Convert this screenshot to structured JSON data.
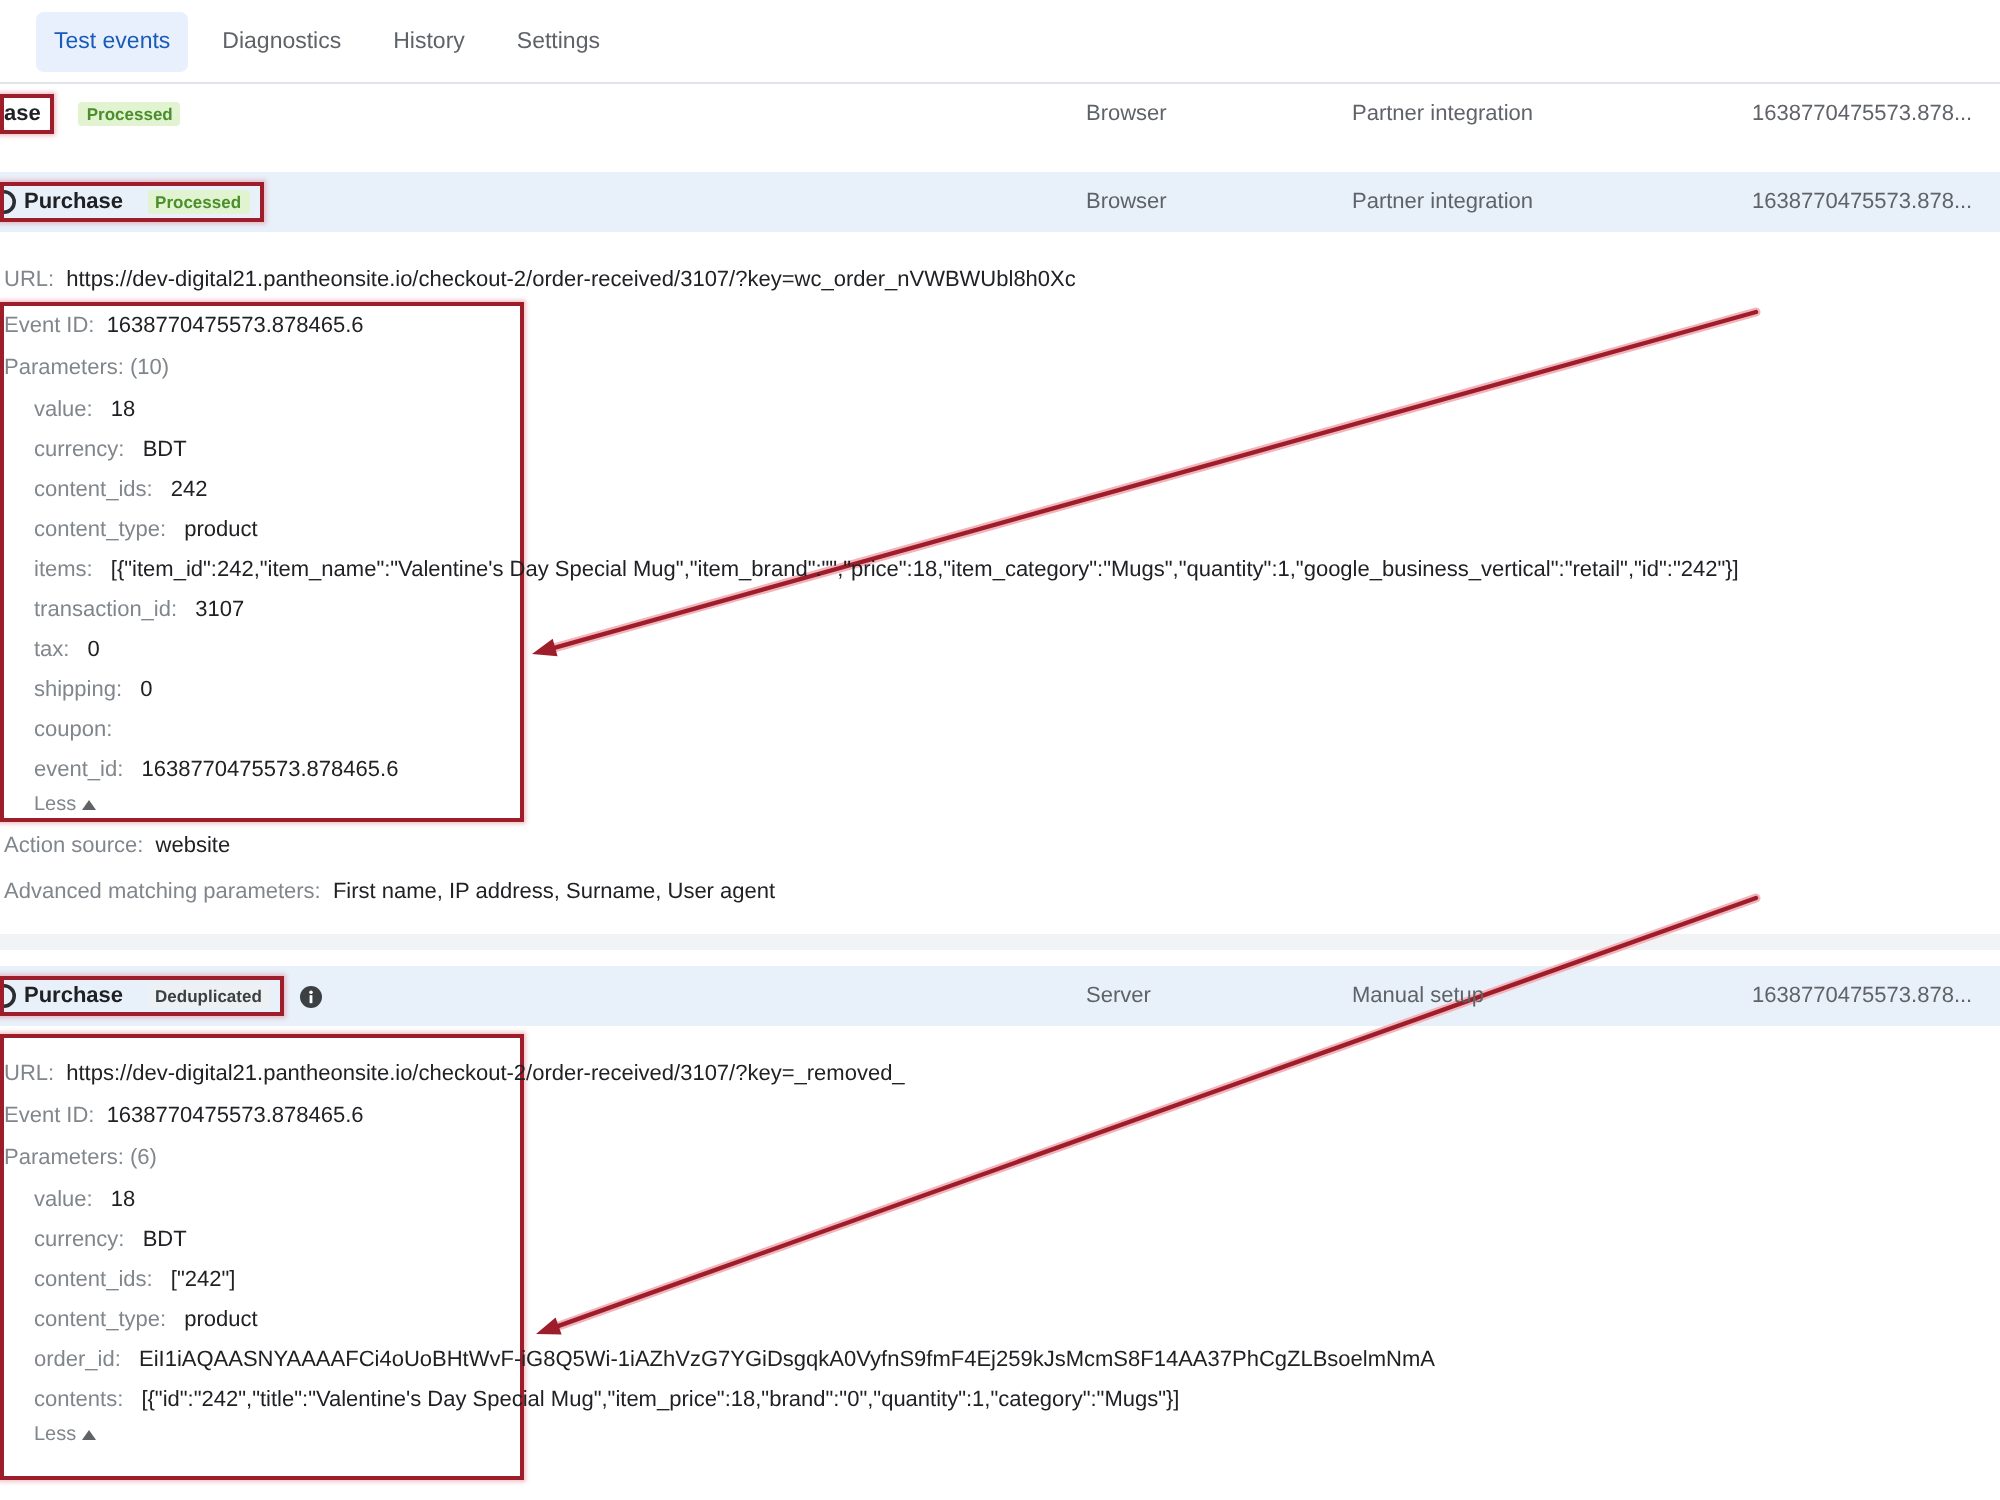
{
  "tabs": [
    {
      "label": "Test events",
      "selected": true
    },
    {
      "label": "Diagnostics",
      "selected": false
    },
    {
      "label": "History",
      "selected": false
    },
    {
      "label": "Settings",
      "selected": false
    }
  ],
  "events": [
    {
      "name": "ase",
      "icon": false,
      "status": {
        "label": "Processed",
        "kind": "success"
      },
      "info_icon": false,
      "column_3": "Browser",
      "column_4": "Partner integration",
      "column_5": "1638770475573.878...",
      "expanded": false,
      "name_framed": true,
      "status_framed": false
    },
    {
      "name": "Purchase",
      "icon": true,
      "status": {
        "label": "Processed",
        "kind": "success"
      },
      "info_icon": false,
      "column_3": "Browser",
      "column_4": "Partner integration",
      "column_5": "1638770475573.878...",
      "expanded": true,
      "name_framed": true,
      "status_framed": true,
      "details": {
        "url_label": "URL:",
        "url": "https://dev-digital21.pantheonsite.io/checkout-2/order-received/3107/?key=wc_order_nVWBWUbl8h0Xc",
        "event_id_label": "Event ID:",
        "event_id": "1638770475573.878465.6",
        "parameters_label": "Parameters: (10)",
        "parameters": [
          {
            "key": "value:",
            "value": "18"
          },
          {
            "key": "currency:",
            "value": "BDT"
          },
          {
            "key": "content_ids:",
            "value": "242"
          },
          {
            "key": "content_type:",
            "value": "product"
          },
          {
            "key": "items:",
            "value": "[{\"item_id\":242,\"item_name\":\"Valentine's Day Special Mug\",\"item_brand\":\"\",\"price\":18,\"item_category\":\"Mugs\",\"quantity\":1,\"google_business_vertical\":\"retail\",\"id\":\"242\"}]"
          },
          {
            "key": "transaction_id:",
            "value": "3107"
          },
          {
            "key": "tax:",
            "value": "0"
          },
          {
            "key": "shipping:",
            "value": "0"
          },
          {
            "key": "coupon:"
          },
          {
            "key": "event_id:",
            "value": "1638770475573.878465.6"
          }
        ],
        "less": "Less",
        "footer": [
          {
            "label": "Action source:",
            "value": "website"
          },
          {
            "label": "Advanced matching parameters:",
            "value": "First name, IP address, Surname, User agent"
          }
        ],
        "framed": true,
        "url_framed": false,
        "arrow": true
      }
    },
    {
      "name": "Purchase",
      "icon": true,
      "status": {
        "label": "Deduplicated",
        "kind": "neutral"
      },
      "info_icon": true,
      "column_3": "Server",
      "column_4": "Manual setup",
      "column_5": "1638770475573.878...",
      "expanded": true,
      "name_framed": true,
      "status_framed": true,
      "details": {
        "url_label": "URL:",
        "url": "https://dev-digital21.pantheonsite.io/checkout-2/order-received/3107/?key=_removed_",
        "event_id_label": "Event ID:",
        "event_id": "1638770475573.878465.6",
        "parameters_label": "Parameters: (6)",
        "parameters": [
          {
            "key": "value:",
            "value": "18"
          },
          {
            "key": "currency:",
            "value": "BDT"
          },
          {
            "key": "content_ids:",
            "value": "[\"242\"]"
          },
          {
            "key": "content_type:",
            "value": "product"
          },
          {
            "key": "order_id:",
            "value": "EiI1iAQAASNYAAAAFCi4oUoBHtWvF-iG8Q5Wi-1iAZhVzG7YGiDsgqkA0VyfnS9fmF4Ej259kJsMcmS8F14AA37PhCgZLBsoelmNmA"
          },
          {
            "key": "contents:",
            "value": "[{\"id\":\"242\",\"title\":\"Valentine's Day Special Mug\",\"item_price\":18,\"brand\":\"0\",\"quantity\":1,\"category\":\"Mugs\"}]"
          }
        ],
        "less": "Less",
        "framed": true,
        "url_framed": true,
        "arrow": true
      }
    }
  ]
}
